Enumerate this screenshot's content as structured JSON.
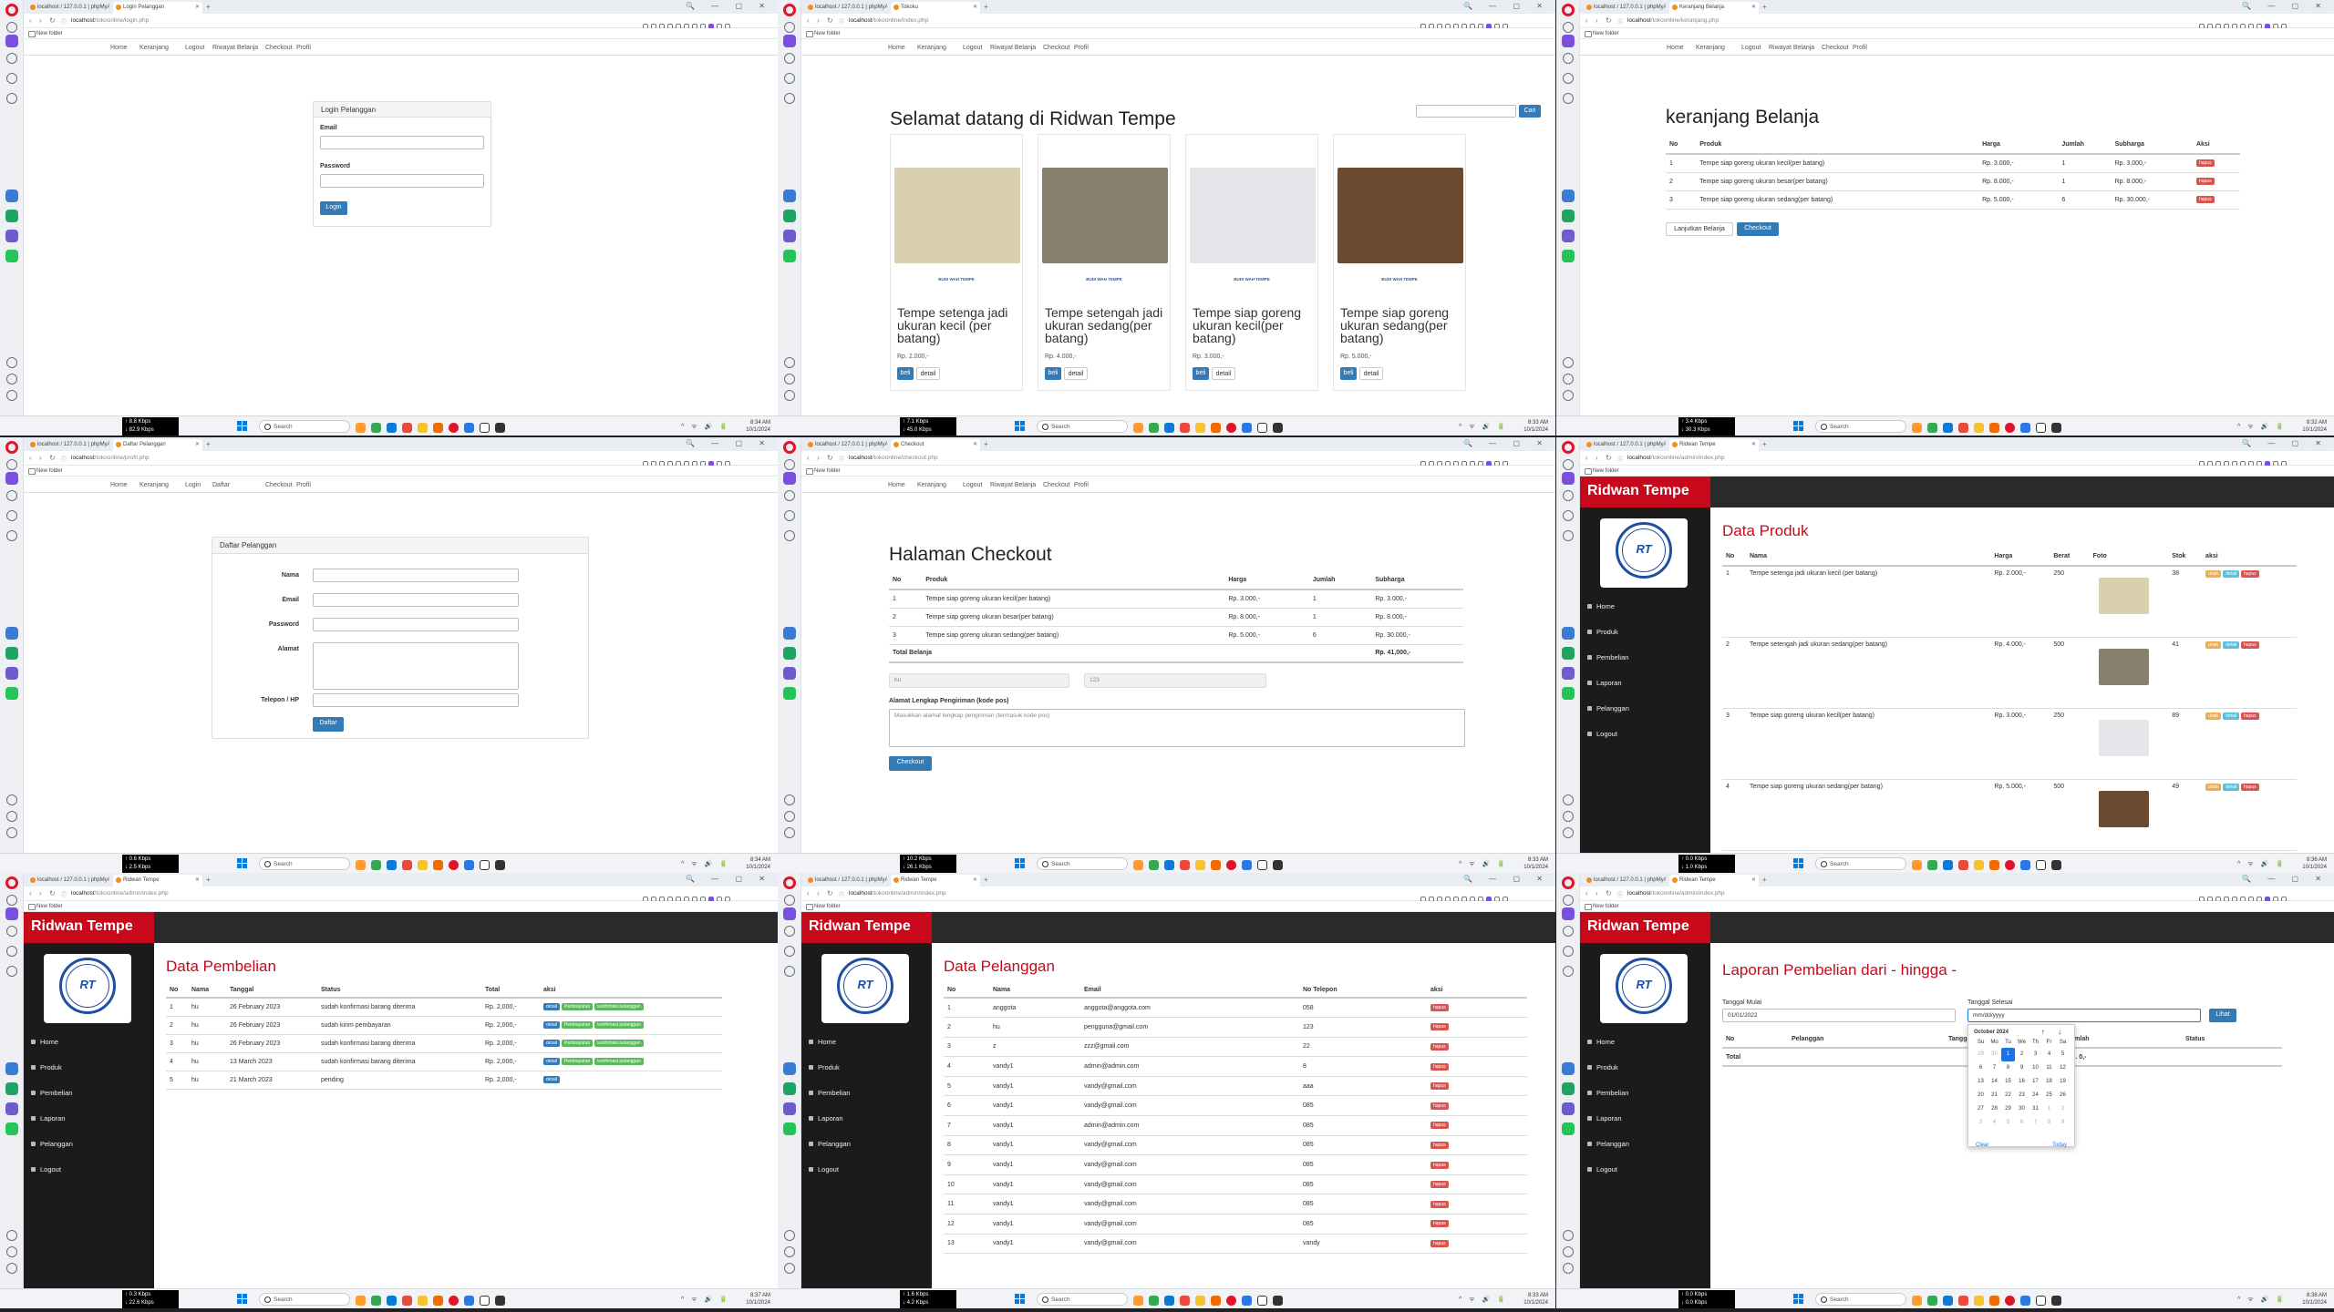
{
  "browser": {
    "tab_first": "localhost / 127.0.0.1 | phpMyAdmin",
    "bookmark": "New folder",
    "search_placeholder": "Search"
  },
  "store_nav": [
    "Home",
    "Keranjang",
    "Logout",
    "Riwayat Belanja",
    "Checkout",
    "Profil"
  ],
  "store_nav_guest": [
    "Home",
    "Keranjang",
    "Login",
    "Daftar",
    "Checkout",
    "Profil"
  ],
  "panels": {
    "login": {
      "tab": "Login Pelanggan",
      "url_host": "localhost",
      "url_path": "/tokoonline/login.php",
      "heading": "Login Pelanggan",
      "email_label": "Email",
      "password_label": "Password",
      "button": "Login",
      "net": [
        "↑ 8.8 Kbps",
        "↓ 82.9 Kbps"
      ],
      "time": "8:34 AM",
      "date": "10/1/2024"
    },
    "home": {
      "tab": "Tokoku",
      "url_host": "localhost",
      "url_path": "/tokoonline/index.php",
      "title": "Selamat datang di Ridwan Tempe",
      "search_button": "Cari",
      "products": [
        {
          "name": "Tempe setenga jadi ukuran kecil (per batang)",
          "price": "Rp. 2.000,-",
          "label": "BUDI WAH TEMPE",
          "color": "#d9d0b0"
        },
        {
          "name": "Tempe setengah jadi ukuran sedang(per batang)",
          "price": "Rp. 4.000,-",
          "label": "BUDI WAH TEMPE",
          "color": "#8a8070"
        },
        {
          "name": "Tempe siap goreng ukuran kecil(per batang)",
          "price": "Rp. 3.000,-",
          "label": "BUDI WAH TEMPE",
          "color": "#e4e6ea"
        },
        {
          "name": "Tempe siap goreng ukuran sedang(per batang)",
          "price": "Rp. 5.000,-",
          "label": "BUDI WAH TEMPE",
          "color": "#6b4a30"
        }
      ],
      "buy": "beli",
      "detail": "detail",
      "net": [
        "↑ 7.1 Kbps",
        "↓ 45.0 Kbps"
      ],
      "time": "8:33 AM",
      "date": "10/1/2024"
    },
    "cart": {
      "tab": "Keranjang Belanja",
      "url_host": "localhost",
      "url_path": "/tokoonline/keranjang.php",
      "title": "keranjang Belanja",
      "headers": [
        "No",
        "Produk",
        "Harga",
        "Jumlah",
        "Subharga",
        "Aksi"
      ],
      "rows": [
        [
          "1",
          "Tempe siap goreng ukuran kecil(per batang)",
          "Rp. 3.000,-",
          "1",
          "Rp. 3.000,-"
        ],
        [
          "2",
          "Tempe siap goreng ukuran besar(per batang)",
          "Rp. 8.000,-",
          "1",
          "Rp. 8.000,-"
        ],
        [
          "3",
          "Tempe siap goreng ukuran sedang(per batang)",
          "Rp. 5.000,-",
          "6",
          "Rp. 30.000,-"
        ]
      ],
      "delete": "hapus",
      "continue": "Lanjutkan Belanja",
      "checkout": "Checkout",
      "net": [
        "↑ 3.4 Kbps",
        "↓ 30.3 Kbps"
      ],
      "time": "8:32 AM",
      "date": "10/1/2024"
    },
    "register": {
      "tab": "Daftar Pelanggan",
      "url_host": "localhost",
      "url_path": "/tokoonline/profil.php",
      "heading": "Daftar Pelanggan",
      "fields": [
        "Nama",
        "Email",
        "Password",
        "Alamat",
        "Telepon / HP"
      ],
      "button": "Daftar",
      "net": [
        "↑ 0.6 Kbps",
        "↓ 2.5 Kbps"
      ],
      "time": "8:34 AM",
      "date": "10/1/2024"
    },
    "checkout": {
      "tab": "Checkout",
      "url_host": "localhost",
      "url_path": "/tokoonline/checkout.php",
      "title": "Halaman Checkout",
      "headers": [
        "No",
        "Produk",
        "Harga",
        "Jumlah",
        "Subharga"
      ],
      "rows": [
        [
          "1",
          "Tempe siap goreng ukuran kecil(per batang)",
          "Rp. 3.000,-",
          "1",
          "Rp. 3.000,-"
        ],
        [
          "2",
          "Tempe siap goreng ukuran besar(per batang)",
          "Rp. 8.000,-",
          "1",
          "Rp. 8.000,-"
        ],
        [
          "3",
          "Tempe siap goreng ukuran sedang(per batang)",
          "Rp. 5.000,-",
          "6",
          "Rp. 30.000,-"
        ]
      ],
      "total_label": "Total Belanja",
      "total": "Rp. 41,000,-",
      "name_value": "hu",
      "phone_value": "123",
      "address_label": "Alamat Lengkap Pengiriman (kode pos)",
      "address_placeholder": "Masukkan alamat lengkap pengiriman (termasuk kode pos)",
      "button": "Checkout",
      "net": [
        "↑ 10.2 Kbps",
        "↓ 26.1 Kbps"
      ],
      "time": "8:33 AM",
      "date": "10/1/2024"
    },
    "admin_produk": {
      "tab": "Ridwan Tempe",
      "url_host": "localhost",
      "url_path": "/tokoonline/admin/index.php",
      "title": "Data Produk",
      "headers": [
        "No",
        "Nama",
        "Harga",
        "Berat",
        "Foto",
        "Stok",
        "aksi"
      ],
      "rows": [
        [
          "1",
          "Tempe setenga jadi ukuran kecil (per batang)",
          "Rp. 2.000,-",
          "250",
          "38",
          "#d9d0b0"
        ],
        [
          "2",
          "Tempe setengah jadi ukuran sedang(per batang)",
          "Rp. 4.000,-",
          "500",
          "41",
          "#8a8070"
        ],
        [
          "3",
          "Tempe siap goreng ukuran kecil(per batang)",
          "Rp. 3.000,-",
          "250",
          "89",
          "#e4e6ea"
        ],
        [
          "4",
          "Tempe siap goreng ukuran sedang(per batang)",
          "Rp. 5.000,-",
          "500",
          "49",
          "#6b4a30"
        ]
      ],
      "actions": [
        "ubah",
        "detail",
        "hapus"
      ],
      "net": [
        "↑ 0.0 Kbps",
        "↓ 1.0 Kbps"
      ],
      "time": "8:36 AM",
      "date": "10/1/2024"
    },
    "admin_pembelian": {
      "tab": "Ridwan Tempe",
      "url_host": "localhost",
      "url_path": "/tokoonline/admin/index.php",
      "title": "Data Pembelian",
      "headers": [
        "No",
        "Nama",
        "Tanggal",
        "Status",
        "Total",
        "aksi"
      ],
      "rows": [
        [
          "1",
          "hu",
          "26 February 2023",
          "sudah konfirmasi barang diterima",
          "Rp. 2,000,-"
        ],
        [
          "2",
          "hu",
          "26 February 2023",
          "sudah kirim pembayaran",
          "Rp. 2,000,-"
        ],
        [
          "3",
          "hu",
          "26 February 2023",
          "sudah konfirmasi barang diterima",
          "Rp. 2,000,-"
        ],
        [
          "4",
          "hu",
          "13 March 2023",
          "sudah konfirmasi barang diterima",
          "Rp. 2,000,-"
        ],
        [
          "5",
          "hu",
          "21 March 2023",
          "pending",
          "Rp. 2,000,-"
        ]
      ],
      "actions": [
        "detail",
        "Pembayaran",
        "konfirmasi pelanggan"
      ],
      "net": [
        "↑ 0.3 Kbps",
        "↓ 22.6 Kbps"
      ],
      "time": "8:37 AM",
      "date": "10/1/2024"
    },
    "admin_pelanggan": {
      "tab": "Ridwan Tempe",
      "url_host": "localhost",
      "url_path": "/tokoonline/admin/index.php",
      "title": "Data Pelanggan",
      "headers": [
        "No",
        "Nama",
        "Email",
        "No Telepon",
        "aksi"
      ],
      "rows": [
        [
          "1",
          "anggota",
          "anggota@anggota.com",
          "058"
        ],
        [
          "2",
          "hu",
          "pengguna@gmail.com",
          "123"
        ],
        [
          "3",
          "z",
          "zzz@gmail.com",
          "22"
        ],
        [
          "4",
          "vandy1",
          "admin@admin.com",
          "8"
        ],
        [
          "5",
          "vandy1",
          "vandy@gmail.com",
          "aaa"
        ],
        [
          "6",
          "vandy1",
          "vandy@gmail.com",
          "085"
        ],
        [
          "7",
          "vandy1",
          "admin@admin.com",
          "085"
        ],
        [
          "8",
          "vandy1",
          "vandy@gmail.com",
          "085"
        ],
        [
          "9",
          "vandy1",
          "vandy@gmail.com",
          "085"
        ],
        [
          "10",
          "vandy1",
          "vandy@gmail.com",
          "085"
        ],
        [
          "11",
          "vandy1",
          "vandy@gmail.com",
          "085"
        ],
        [
          "12",
          "vandy1",
          "vandy@gmail.com",
          "085"
        ],
        [
          "13",
          "vandy1",
          "vandy@gmail.com",
          "vandy"
        ]
      ],
      "delete": "hapus",
      "net": [
        "↑ 1.6 Kbps",
        "↓ 4.2 Kbps"
      ],
      "time": "8:33 AM",
      "date": "10/1/2024"
    },
    "admin_laporan": {
      "tab": "Ridwan Tempe",
      "url_host": "localhost",
      "url_path": "/tokoonline/admin/index.php",
      "title": "Laporan Pembelian dari - hingga -",
      "start_label": "Tanggal Mulai",
      "end_label": "Tanggal Selesai",
      "start_value": "01/01/2022",
      "end_value": "mm/dd/yyyy",
      "button": "Lihat",
      "headers": [
        "No",
        "Pelanggan",
        "Tanggal",
        "Jumlah",
        "Status"
      ],
      "total_label": "Total",
      "total_value": "Rp. 0,-",
      "calendar": {
        "month": "October 2024",
        "weekdays": [
          "Su",
          "Mo",
          "Tu",
          "We",
          "Th",
          "Fr",
          "Sa"
        ],
        "days": [
          "29",
          "30",
          "1",
          "2",
          "3",
          "4",
          "5",
          "6",
          "7",
          "8",
          "9",
          "10",
          "11",
          "12",
          "13",
          "14",
          "15",
          "16",
          "17",
          "18",
          "19",
          "20",
          "21",
          "22",
          "23",
          "24",
          "25",
          "26",
          "27",
          "28",
          "29",
          "30",
          "31",
          "1",
          "2",
          "3",
          "4",
          "5",
          "6",
          "7",
          "8",
          "9"
        ],
        "clear": "Clear",
        "today": "Today"
      },
      "net": [
        "↑ 0.0 Kbps",
        "↓ 0.0 Kbps"
      ],
      "time": "8:38 AM",
      "date": "10/1/2024"
    }
  },
  "admin": {
    "brand": "Ridwan Tempe",
    "logo_text": "RT",
    "menu": [
      "Home",
      "Produk",
      "Pembelian",
      "Laporan",
      "Pelanggan",
      "Logout"
    ]
  },
  "colors": {
    "brand_red": "#c8081b",
    "primary": "#337ab7",
    "danger": "#d9534f"
  }
}
